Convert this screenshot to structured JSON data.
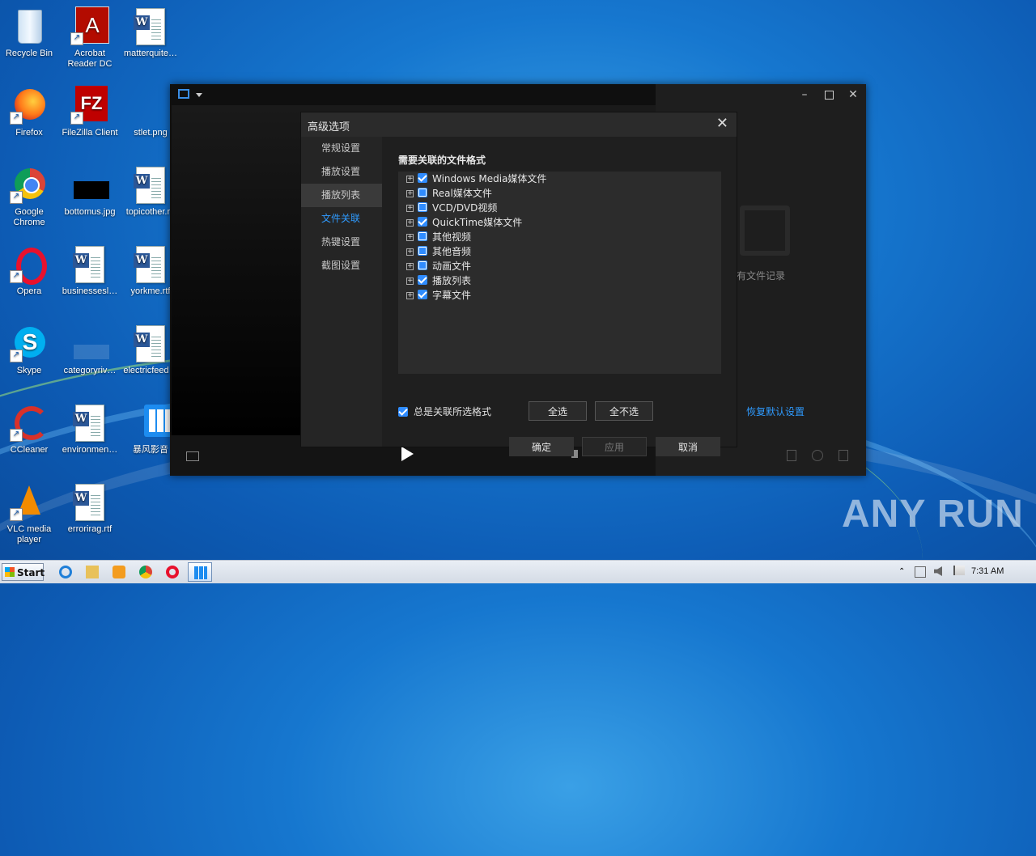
{
  "desktop": {
    "icons": [
      {
        "label": "Recycle Bin"
      },
      {
        "label": "Acrobat Reader DC"
      },
      {
        "label": "matterquite…"
      },
      {
        "label": "Firefox"
      },
      {
        "label": "FileZilla Client"
      },
      {
        "label": "stlet.png"
      },
      {
        "label": "Google Chrome"
      },
      {
        "label": "bottomus.jpg"
      },
      {
        "label": "topicother.rtf"
      },
      {
        "label": "Opera"
      },
      {
        "label": "businessesl…"
      },
      {
        "label": "yorkme.rtf"
      },
      {
        "label": "Skype"
      },
      {
        "label": "categoryriv…"
      },
      {
        "label": "electricfeed…"
      },
      {
        "label": "CCleaner"
      },
      {
        "label": "environmen…"
      },
      {
        "label": "暴风影音"
      },
      {
        "label": "VLC media player"
      },
      {
        "label": "errorirag.rtf"
      }
    ],
    "watermark": "ANY RUN"
  },
  "player": {
    "empty_history_text": "有文件记录"
  },
  "dialog": {
    "title": "高级选项",
    "nav": [
      {
        "label": "常规设置"
      },
      {
        "label": "播放设置"
      },
      {
        "label": "播放列表"
      },
      {
        "label": "文件关联"
      },
      {
        "label": "热键设置"
      },
      {
        "label": "截图设置"
      }
    ],
    "section_title": "需要关联的文件格式",
    "formats": [
      {
        "label": "Windows Media媒体文件",
        "state": "checked"
      },
      {
        "label": "Real媒体文件",
        "state": "partial"
      },
      {
        "label": "VCD/DVD视频",
        "state": "partial"
      },
      {
        "label": "QuickTime媒体文件",
        "state": "checked"
      },
      {
        "label": "其他视频",
        "state": "partial"
      },
      {
        "label": "其他音频",
        "state": "partial"
      },
      {
        "label": "动画文件",
        "state": "partial"
      },
      {
        "label": "播放列表",
        "state": "checked"
      },
      {
        "label": "字幕文件",
        "state": "checked"
      }
    ],
    "always_associate": {
      "label": "总是关联所选格式",
      "checked": true
    },
    "select_all": "全选",
    "select_none": "全不选",
    "restore_defaults": "恢复默认设置",
    "ok": "确定",
    "apply": "应用",
    "cancel": "取消"
  },
  "taskbar": {
    "start_label": "Start",
    "clock": "7:31 AM"
  },
  "colors": {
    "accent": "#2f9bff",
    "dialog_bg": "#2b2b2b",
    "taskbar_bg": "#dfe5ee"
  }
}
